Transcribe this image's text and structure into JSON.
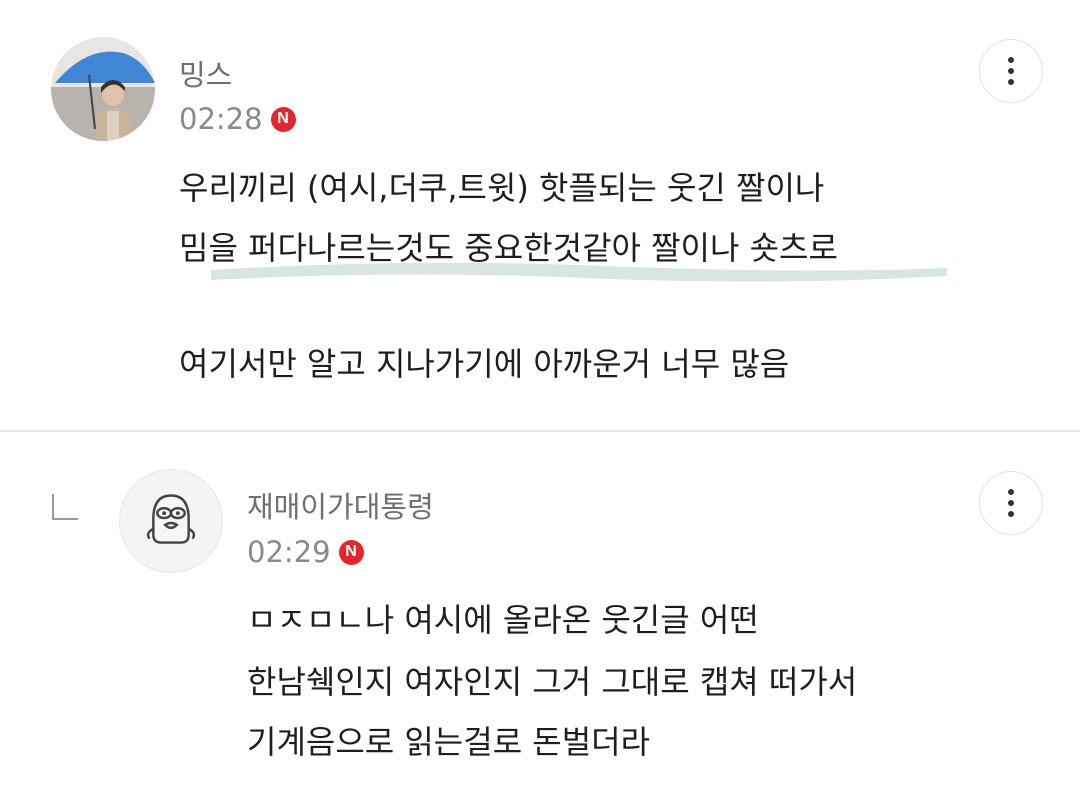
{
  "comments": [
    {
      "nickname": "밍스",
      "time": "02:28",
      "badge": "N",
      "lines": [
        "우리끼리 (여시,더쿠,트윗) 핫플되는 웃긴 짤이나",
        "밈을 퍼다나르는것도 중요한것같아 짤이나 숏츠로",
        "여기서만 알고 지나가기에 아까운거 너무 많음"
      ]
    },
    {
      "nickname": "재매이가대통령",
      "time": "02:29",
      "badge": "N",
      "lines": [
        "ㅁㅈㅁㄴ나 여시에 올라온 웃긴글 어떤",
        "한남쉑인지 여자인지 그거 그대로 캡쳐 떠가서",
        "기계음으로 읽는걸로 돈벌더라"
      ]
    }
  ],
  "colors": {
    "badge": "#e3262c",
    "highlight": "#d9e6e0",
    "divider": "#e6e6e6"
  },
  "icons": [
    "more-options-icon",
    "reply-arrow-icon",
    "new-badge-icon"
  ]
}
